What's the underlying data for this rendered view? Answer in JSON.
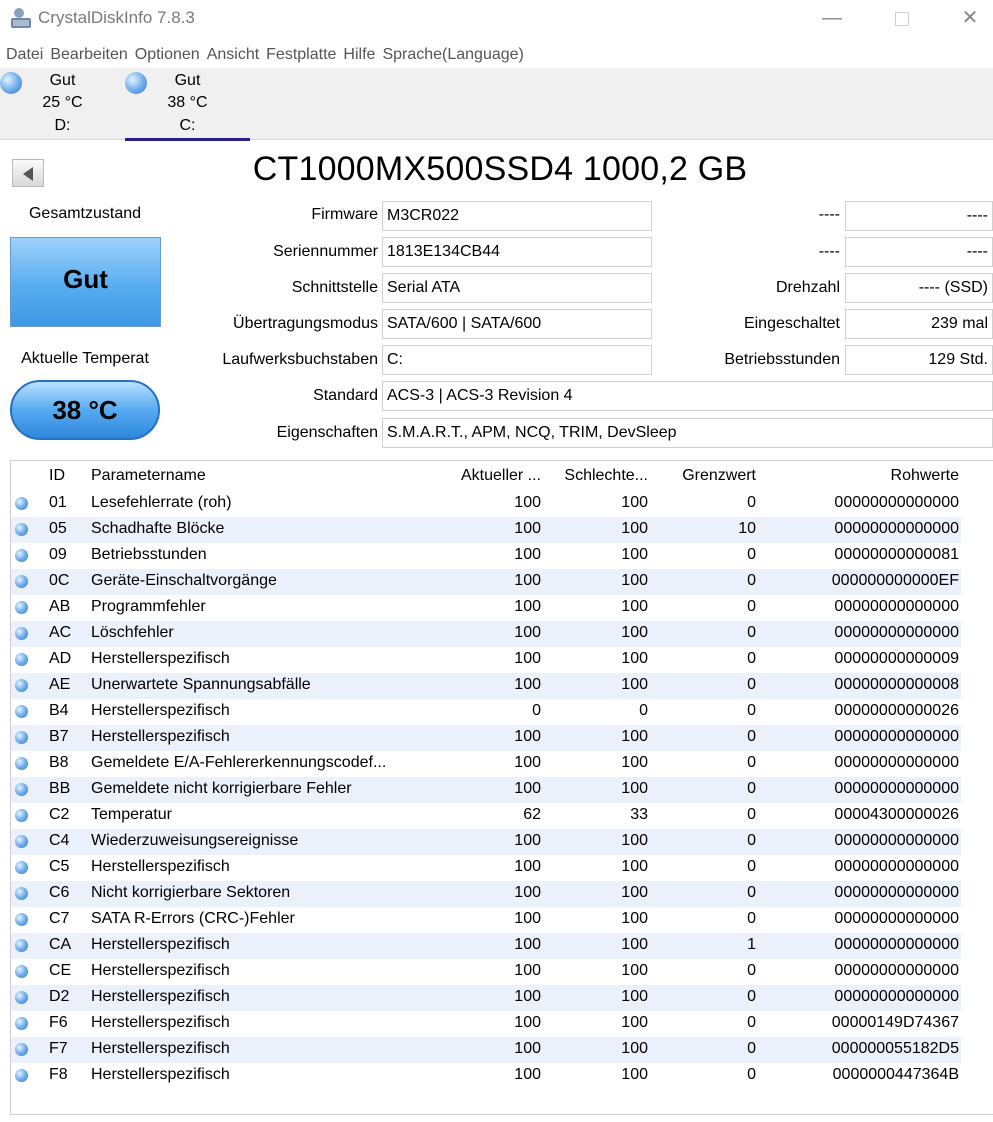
{
  "window": {
    "title": "CrystalDiskInfo 7.8.3",
    "min": "—",
    "close": "✕"
  },
  "menu": [
    "Datei",
    "Bearbeiten",
    "Optionen",
    "Ansicht",
    "Festplatte",
    "Hilfe",
    "Sprache(Language)"
  ],
  "disks": [
    {
      "status": "Gut",
      "temp": "25 °C",
      "drive": "D:"
    },
    {
      "status": "Gut",
      "temp": "38 °C",
      "drive": "C:"
    }
  ],
  "model": "CT1000MX500SSD4 1000,2 GB",
  "health": {
    "label": "Gesamtzustand",
    "value": "Gut"
  },
  "temperature": {
    "label": "Aktuelle Temperat",
    "value": "38 °C"
  },
  "info": {
    "firmware": {
      "label": "Firmware",
      "value": "M3CR022"
    },
    "serial": {
      "label": "Seriennummer",
      "value": "1813E134CB44"
    },
    "interface": {
      "label": "Schnittstelle",
      "value": "Serial ATA"
    },
    "transfer": {
      "label": "Übertragungsmodus",
      "value": "SATA/600 | SATA/600"
    },
    "letters": {
      "label": "Laufwerksbuchstaben",
      "value": "C:"
    },
    "standard": {
      "label": "Standard",
      "value": "ACS-3 | ACS-3 Revision 4"
    },
    "features": {
      "label": "Eigenschaften",
      "value": "S.M.A.R.T., APM, NCQ, TRIM, DevSleep"
    },
    "r1": {
      "label": "----",
      "value": "----"
    },
    "r2": {
      "label": "----",
      "value": "----"
    },
    "rpm": {
      "label": "Drehzahl",
      "value": "---- (SSD)"
    },
    "power_count": {
      "label": "Eingeschaltet",
      "value": "239 mal"
    },
    "power_hours": {
      "label": "Betriebsstunden",
      "value": "129 Std."
    }
  },
  "smart": {
    "headers": [
      "ID",
      "Parametername",
      "Aktueller ...",
      "Schlechte...",
      "Grenzwert",
      "Rohwerte"
    ],
    "rows": [
      [
        "01",
        "Lesefehlerrate (roh)",
        "100",
        "100",
        "0",
        "00000000000000"
      ],
      [
        "05",
        "Schadhafte Blöcke",
        "100",
        "100",
        "10",
        "00000000000000"
      ],
      [
        "09",
        "Betriebsstunden",
        "100",
        "100",
        "0",
        "00000000000081"
      ],
      [
        "0C",
        "Geräte-Einschaltvorgänge",
        "100",
        "100",
        "0",
        "000000000000EF"
      ],
      [
        "AB",
        "Programmfehler",
        "100",
        "100",
        "0",
        "00000000000000"
      ],
      [
        "AC",
        "Löschfehler",
        "100",
        "100",
        "0",
        "00000000000000"
      ],
      [
        "AD",
        "Herstellerspezifisch",
        "100",
        "100",
        "0",
        "00000000000009"
      ],
      [
        "AE",
        "Unerwartete Spannungsabfälle",
        "100",
        "100",
        "0",
        "00000000000008"
      ],
      [
        "B4",
        "Herstellerspezifisch",
        "0",
        "0",
        "0",
        "00000000000026"
      ],
      [
        "B7",
        "Herstellerspezifisch",
        "100",
        "100",
        "0",
        "00000000000000"
      ],
      [
        "B8",
        "Gemeldete E/A-Fehlererkennungscodef...",
        "100",
        "100",
        "0",
        "00000000000000"
      ],
      [
        "BB",
        "Gemeldete nicht korrigierbare Fehler",
        "100",
        "100",
        "0",
        "00000000000000"
      ],
      [
        "C2",
        "Temperatur",
        "62",
        "33",
        "0",
        "00004300000026"
      ],
      [
        "C4",
        "Wiederzuweisungsereignisse",
        "100",
        "100",
        "0",
        "00000000000000"
      ],
      [
        "C5",
        "Herstellerspezifisch",
        "100",
        "100",
        "0",
        "00000000000000"
      ],
      [
        "C6",
        "Nicht korrigierbare Sektoren",
        "100",
        "100",
        "0",
        "00000000000000"
      ],
      [
        "C7",
        "SATA R-Errors (CRC-)Fehler",
        "100",
        "100",
        "0",
        "00000000000000"
      ],
      [
        "CA",
        "Herstellerspezifisch",
        "100",
        "100",
        "1",
        "00000000000000"
      ],
      [
        "CE",
        "Herstellerspezifisch",
        "100",
        "100",
        "0",
        "00000000000000"
      ],
      [
        "D2",
        "Herstellerspezifisch",
        "100",
        "100",
        "0",
        "00000000000000"
      ],
      [
        "F6",
        "Herstellerspezifisch",
        "100",
        "100",
        "0",
        "00000149D74367"
      ],
      [
        "F7",
        "Herstellerspezifisch",
        "100",
        "100",
        "0",
        "000000055182D5"
      ],
      [
        "F8",
        "Herstellerspezifisch",
        "100",
        "100",
        "0",
        "0000000447364B"
      ]
    ]
  }
}
